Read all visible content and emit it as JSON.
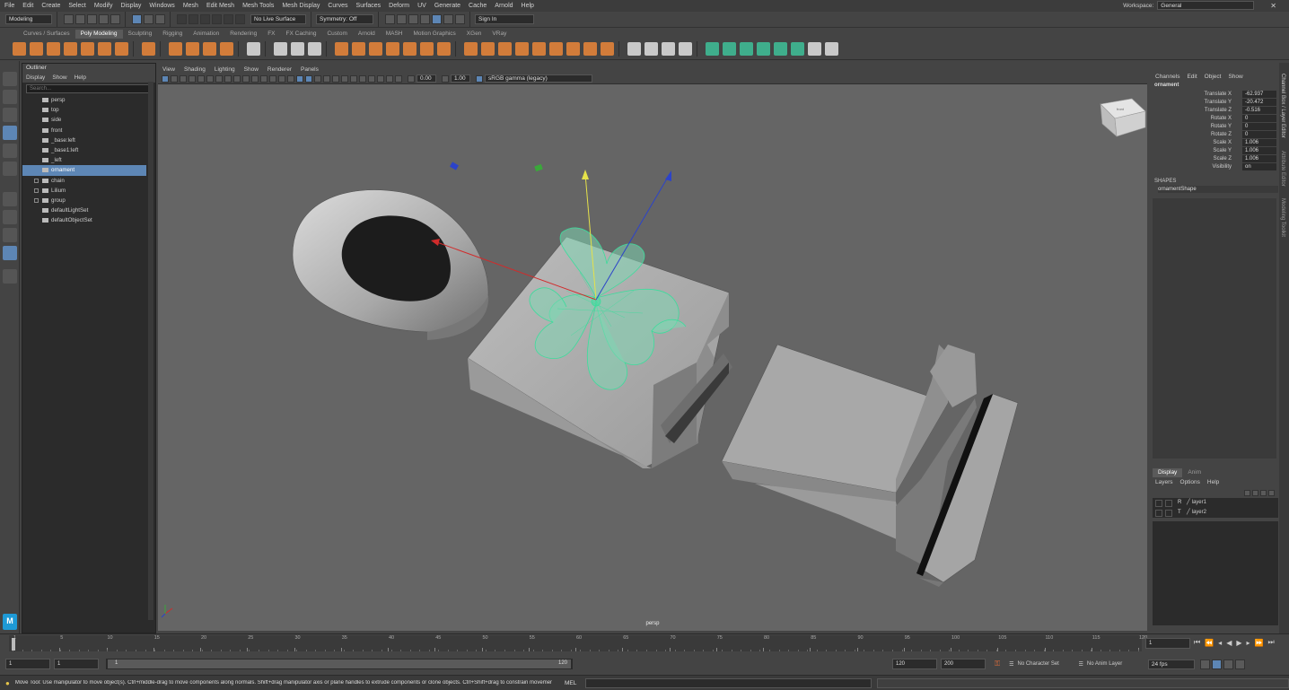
{
  "menubar": {
    "items": [
      "File",
      "Edit",
      "Create",
      "Select",
      "Modify",
      "Display",
      "Windows",
      "Mesh",
      "Edit Mesh",
      "Mesh Tools",
      "Mesh Display",
      "Curves",
      "Surfaces",
      "Deform",
      "UV",
      "Generate",
      "Cache",
      "Arnold",
      "Help"
    ],
    "workspace_label": "Workspace:",
    "workspace_value": "General"
  },
  "statusline": {
    "mode": "Modeling",
    "live_surface": "No Live Surface",
    "symmetry": "Symmetry: Off",
    "sign_in": "Sign In"
  },
  "shelf": {
    "tabs": [
      "Curves / Surfaces",
      "Poly Modeling",
      "Sculpting",
      "Rigging",
      "Animation",
      "Rendering",
      "FX",
      "FX Caching",
      "Custom",
      "Arnold",
      "MASH",
      "Motion Graphics",
      "XGen",
      "VRay"
    ],
    "active_tab": "Poly Modeling"
  },
  "outliner": {
    "title": "Outliner",
    "menu": [
      "Display",
      "Show",
      "Help"
    ],
    "search_placeholder": "Search...",
    "items": [
      {
        "label": "persp",
        "type": "camera",
        "expand": false,
        "selected": false
      },
      {
        "label": "top",
        "type": "camera",
        "expand": false,
        "selected": false
      },
      {
        "label": "side",
        "type": "camera",
        "expand": false,
        "selected": false
      },
      {
        "label": "front",
        "type": "camera",
        "expand": false,
        "selected": false
      },
      {
        "label": "_base:left",
        "type": "camera",
        "expand": false,
        "selected": false
      },
      {
        "label": "_base1:left",
        "type": "camera",
        "expand": false,
        "selected": false
      },
      {
        "label": "_left",
        "type": "camera",
        "expand": false,
        "selected": false
      },
      {
        "label": "ornament",
        "type": "transform",
        "expand": false,
        "selected": true
      },
      {
        "label": "chain",
        "type": "mesh",
        "expand": true,
        "selected": false
      },
      {
        "label": "Lilium",
        "type": "mesh",
        "expand": true,
        "selected": false
      },
      {
        "label": "group",
        "type": "mesh",
        "expand": true,
        "selected": false
      },
      {
        "label": "defaultLightSet",
        "type": "set",
        "expand": false,
        "selected": false
      },
      {
        "label": "defaultObjectSet",
        "type": "set",
        "expand": false,
        "selected": false
      }
    ]
  },
  "viewport": {
    "menu": [
      "View",
      "Shading",
      "Lighting",
      "Show",
      "Renderer",
      "Panels"
    ],
    "exposure": "0.00",
    "gamma": "1.00",
    "color_space": "sRGB gamma (legacy)",
    "camera_label": "persp",
    "viewcube_label": "front"
  },
  "channelbox": {
    "menu": [
      "Channels",
      "Edit",
      "Object",
      "Show"
    ],
    "object_name": "ornament",
    "attributes": [
      {
        "label": "Translate X",
        "value": "-62.937"
      },
      {
        "label": "Translate Y",
        "value": "-20.472"
      },
      {
        "label": "Translate Z",
        "value": "-0.516"
      },
      {
        "label": "Rotate X",
        "value": "0"
      },
      {
        "label": "Rotate Y",
        "value": "0"
      },
      {
        "label": "Rotate Z",
        "value": "0"
      },
      {
        "label": "Scale X",
        "value": "1.006"
      },
      {
        "label": "Scale Y",
        "value": "1.006"
      },
      {
        "label": "Scale Z",
        "value": "1.006"
      },
      {
        "label": "Visibility",
        "value": "on"
      }
    ],
    "shapes_header": "SHAPES",
    "shape_name": "ornamentShape",
    "side_tabs": [
      "Channel Box / Layer Editor",
      "Attribute Editor",
      "Modeling Toolkit"
    ]
  },
  "layers": {
    "tabs": [
      "Display",
      "Anim"
    ],
    "menu": [
      "Layers",
      "Options",
      "Help"
    ],
    "items": [
      {
        "flag": "R",
        "label": "layer1"
      },
      {
        "flag": "T",
        "label": "layer2"
      }
    ]
  },
  "timeslider": {
    "ticks": [
      "1",
      "5",
      "10",
      "15",
      "20",
      "25",
      "30",
      "35",
      "40",
      "45",
      "50",
      "55",
      "60",
      "65",
      "70",
      "75",
      "80",
      "85",
      "90",
      "95",
      "100",
      "105",
      "110",
      "115",
      "120"
    ],
    "current_frame": "1"
  },
  "rangebar": {
    "start": "1",
    "playback_start": "1",
    "range_start_label": "1",
    "range_end_label": "120",
    "playback_end": "120",
    "end": "200",
    "character_set": "No Character Set",
    "anim_layer": "No Anim Layer",
    "fps": "24 fps"
  },
  "helpline": {
    "text": "Move Tool: Use manipulator to move object(s). Ctrl+middle-drag to move components along normals. Shift+drag manipulator axis or plane handles to extrude components or clone objects. Ctrl+Shift+drag to constrain movement to a con",
    "script_lang": "MEL"
  },
  "colors": {
    "selection": "#5d86b5",
    "wireframe": "#3ddc9c",
    "viewport_bg": "#656565",
    "shelf_orange": "#d27c3a"
  }
}
